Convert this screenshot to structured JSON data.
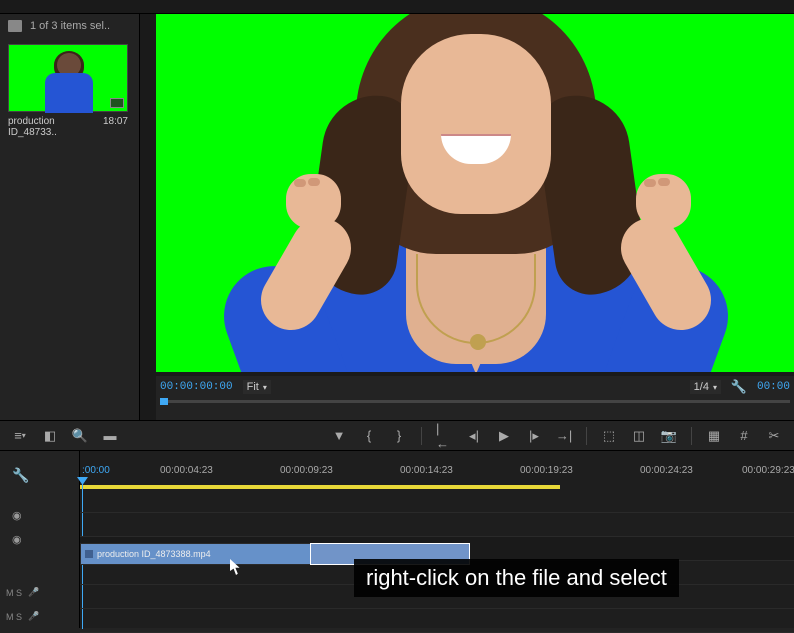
{
  "project": {
    "selection_text": "1 of 3 items sel..",
    "thumb_name": "production ID_48733..",
    "thumb_duration": "18:07"
  },
  "monitor": {
    "timecode": "00:00:00:00",
    "fit_label": "Fit",
    "zoom_label": "1/4",
    "timecode_end": "00:00"
  },
  "timeline": {
    "ruler_start": ":00:00",
    "ticks": [
      "00:00:04:23",
      "00:00:09:23",
      "00:00:14:23",
      "00:00:19:23",
      "00:00:24:23",
      "00:00:29:23"
    ],
    "clip_name": "production ID_4873388.mp4",
    "track_labels": {
      "audio1": "M   S",
      "audio2": "M   S"
    }
  },
  "caption": "right-click on the file and select"
}
